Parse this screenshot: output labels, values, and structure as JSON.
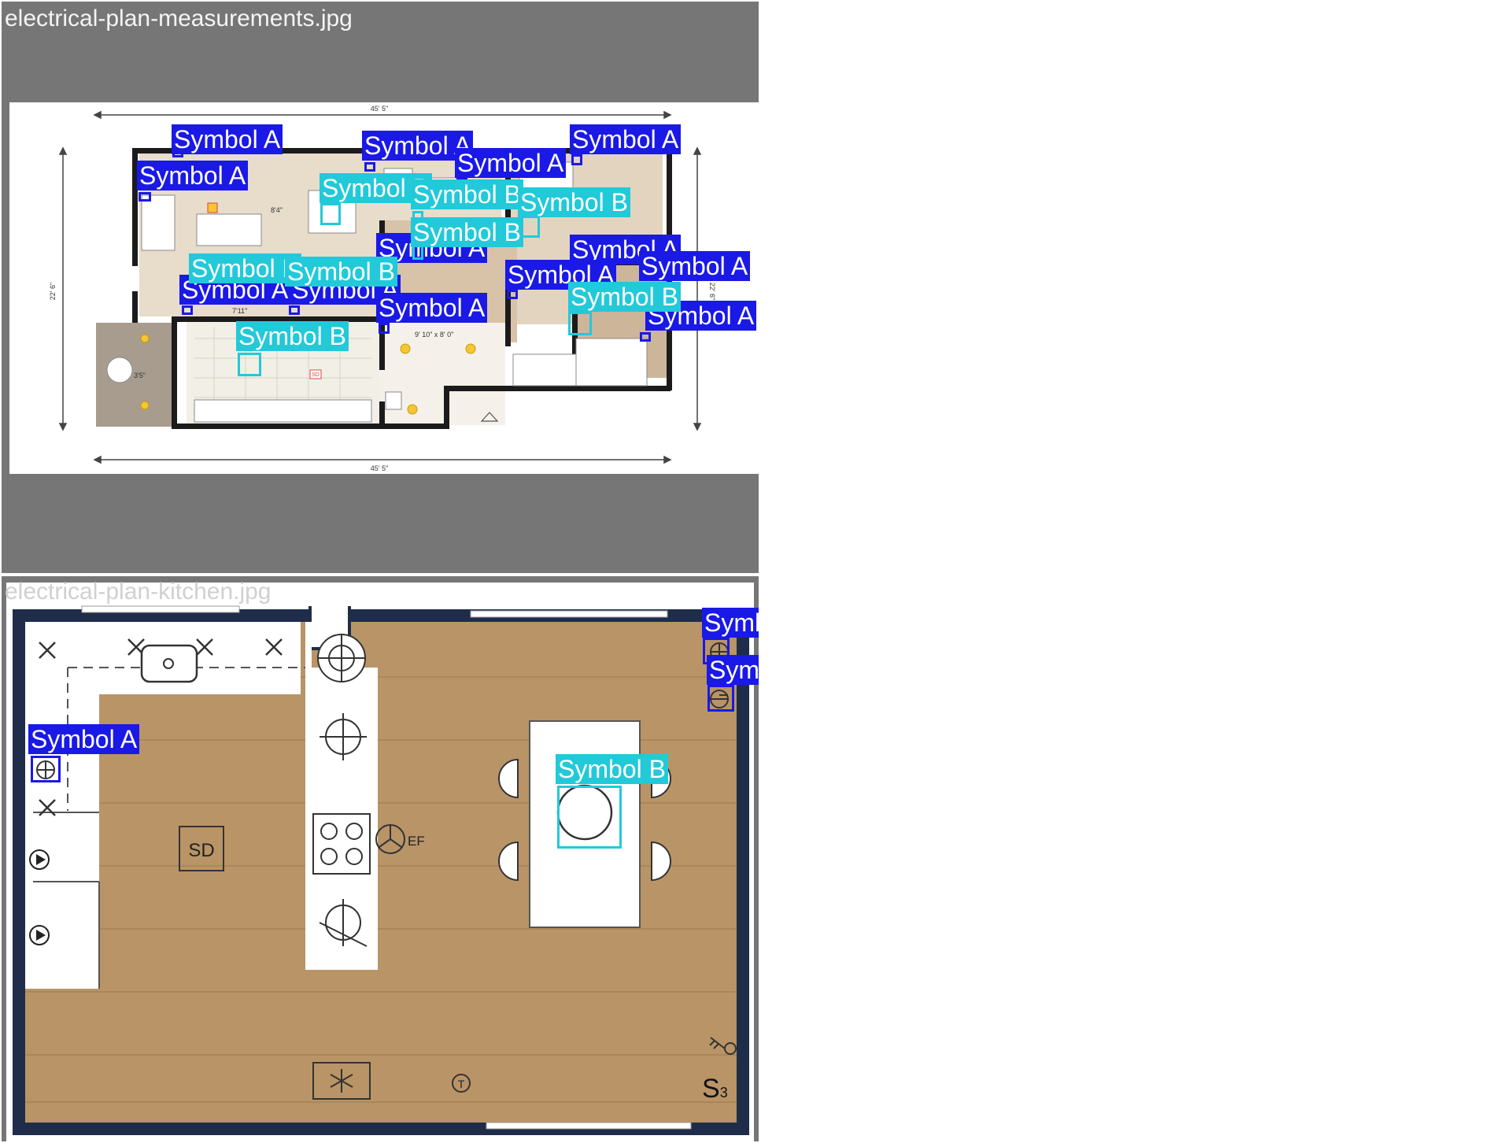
{
  "panels": [
    {
      "title": "electrical-plan-measurements.jpg"
    },
    {
      "title": "electrical-plan-kitchen.jpg"
    }
  ],
  "legend": {
    "a": "Symbol A",
    "b": "Symbol B"
  },
  "measurements_plan": {
    "dims": {
      "top": "45' 5\"",
      "bottom": "45' 5\"",
      "left": "22' 6\"",
      "right": "22' 6\""
    },
    "notes": {
      "living": "8'4\"",
      "hall": "7'11\"",
      "room": "9' 10\" x 8' 0\"",
      "balcony": "3'5\""
    },
    "sd_label": "SD"
  },
  "kitchen_plan": {
    "sd_label": "SD",
    "ef_label": "EF",
    "t_label": "T",
    "s_label": "S",
    "s_sub": "3"
  },
  "colors": {
    "symbol_a": "#1a19e6",
    "symbol_b": "#22c9d9",
    "panel_bg": "#767676"
  }
}
